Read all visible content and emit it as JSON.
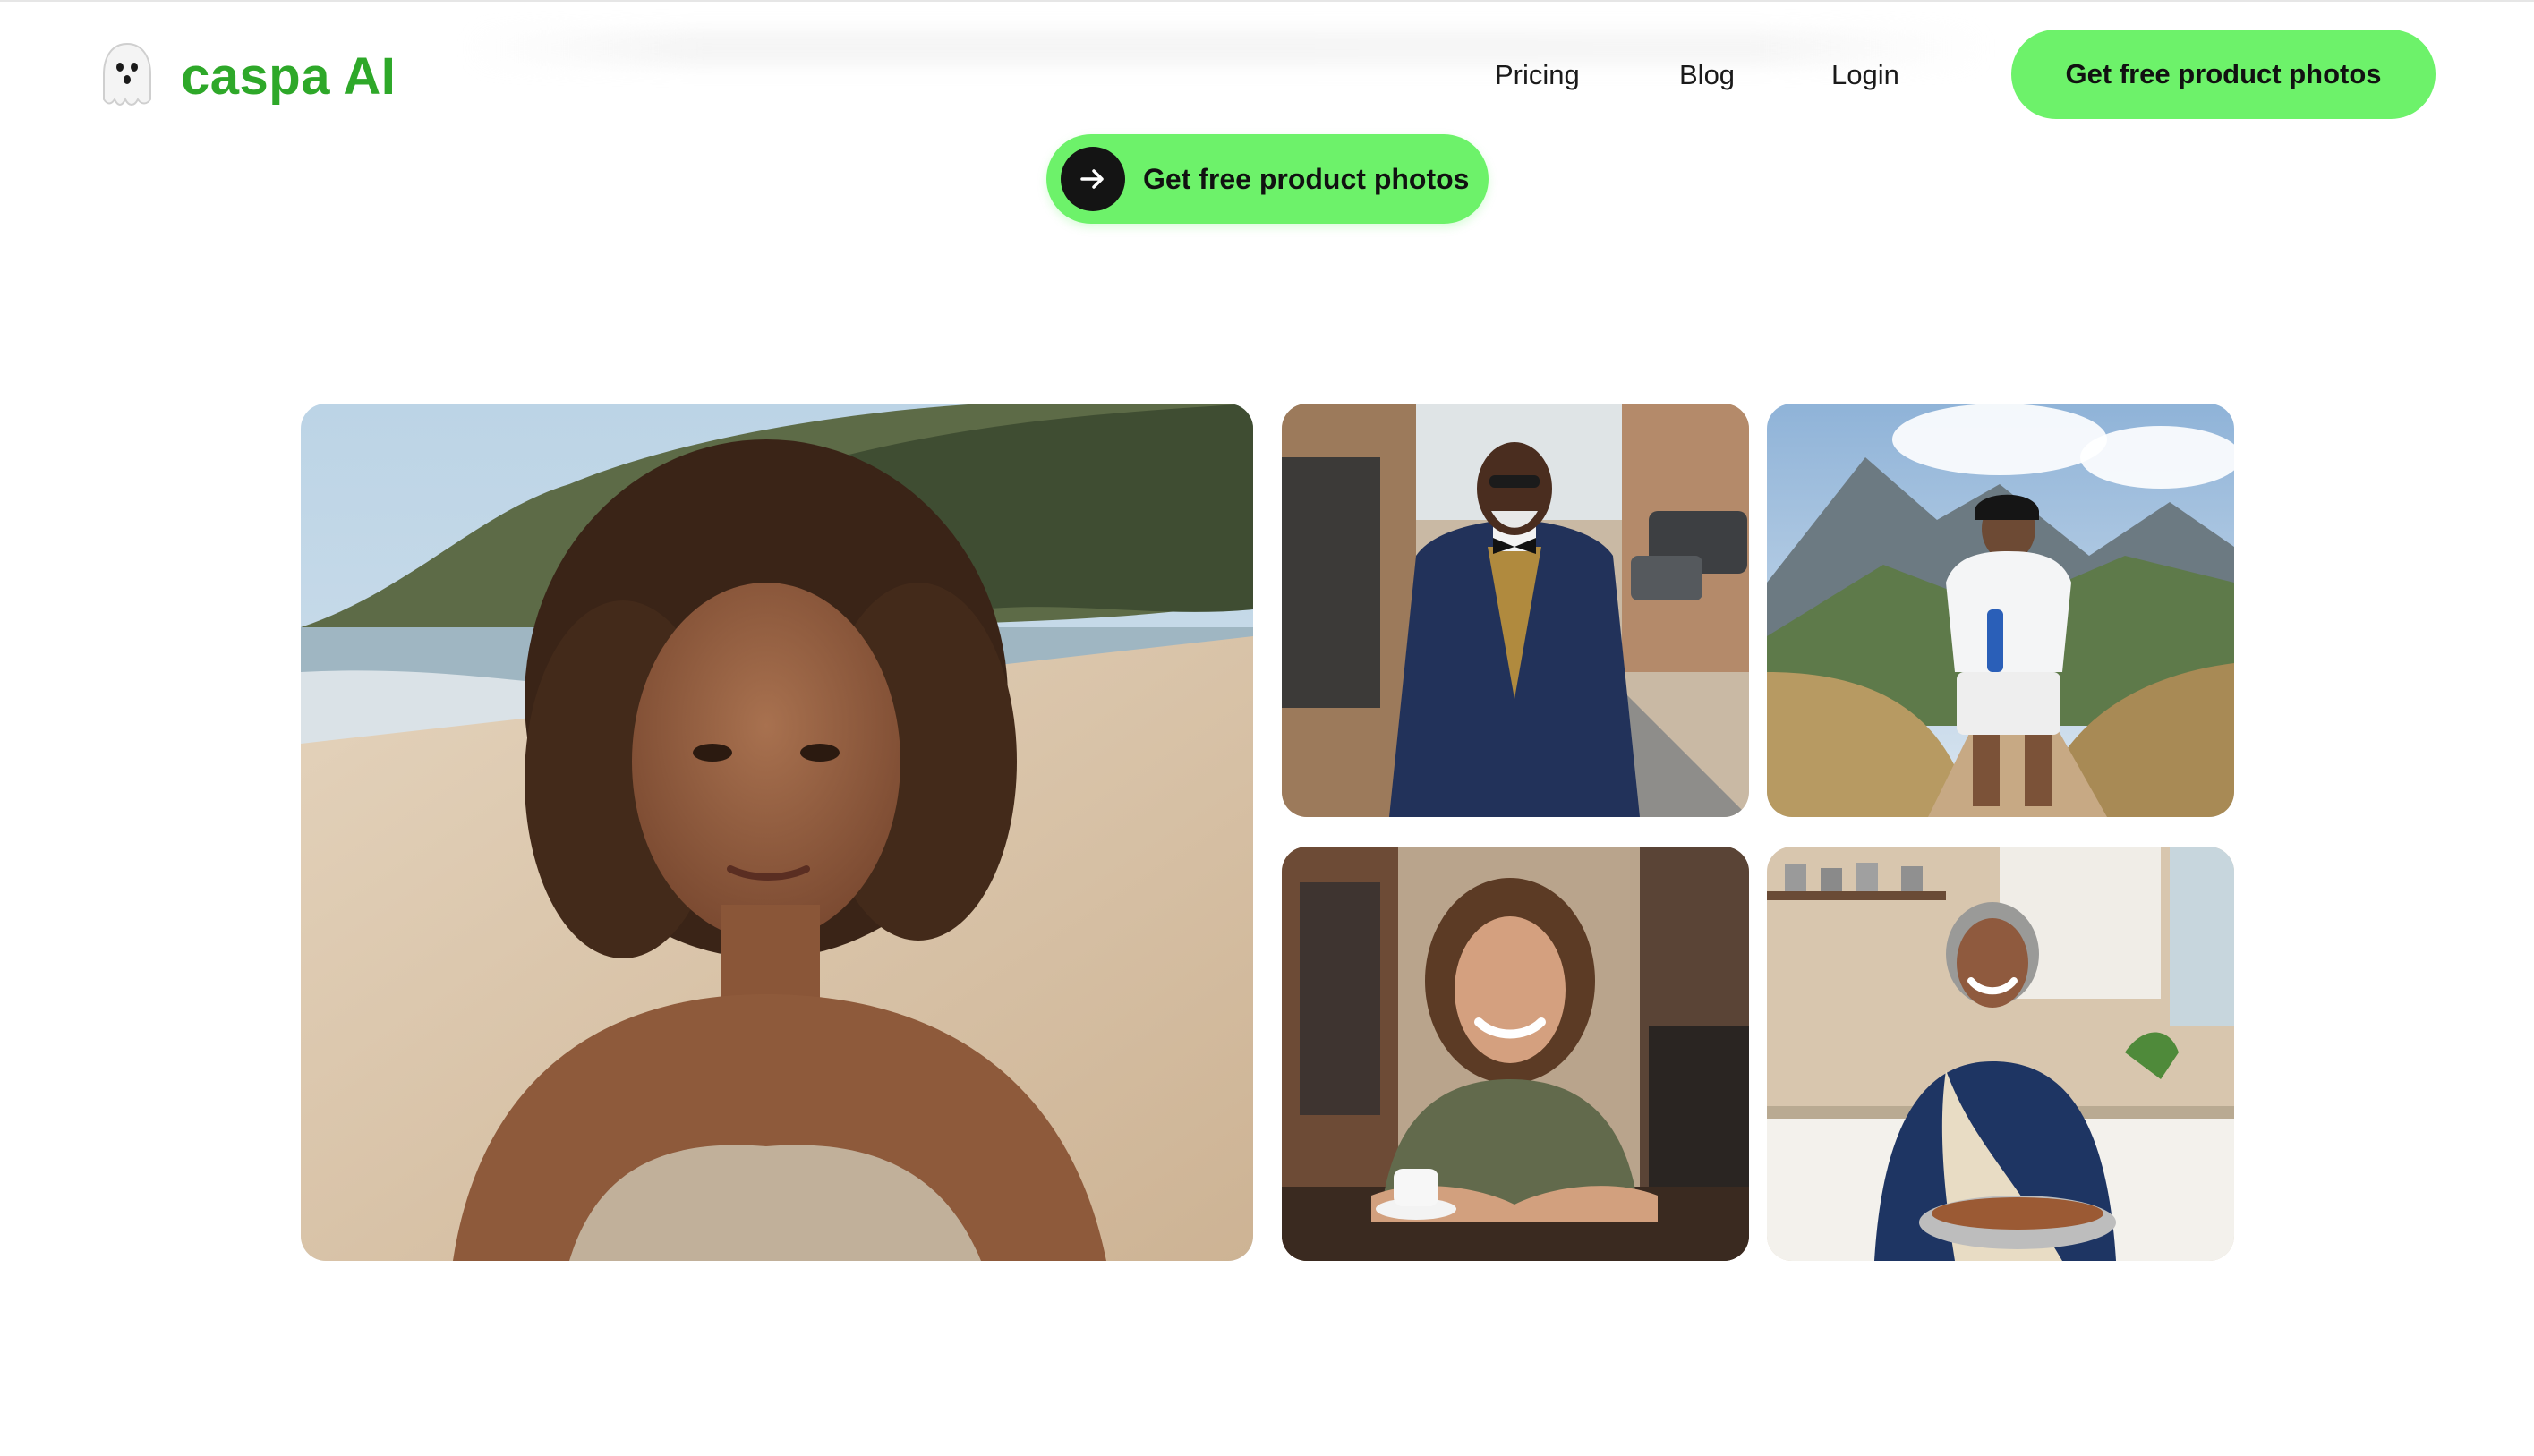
{
  "brand": {
    "name": "caspa AI",
    "logo_icon": "ghost-icon",
    "color": "#2ea829"
  },
  "nav": {
    "items": [
      {
        "label": "Pricing"
      },
      {
        "label": "Blog"
      },
      {
        "label": "Login"
      }
    ],
    "cta_label": "Get free product photos"
  },
  "hero": {
    "cta_label": "Get free product photos",
    "cta_icon": "arrow-right-icon",
    "accent_color": "#6df26a"
  },
  "gallery": {
    "photos": [
      {
        "name": "woman-on-beach-photo"
      },
      {
        "name": "man-in-suit-street-photo"
      },
      {
        "name": "runner-mountain-trail-photo"
      },
      {
        "name": "woman-at-cafe-photo"
      },
      {
        "name": "woman-cooking-kitchen-photo"
      }
    ]
  }
}
